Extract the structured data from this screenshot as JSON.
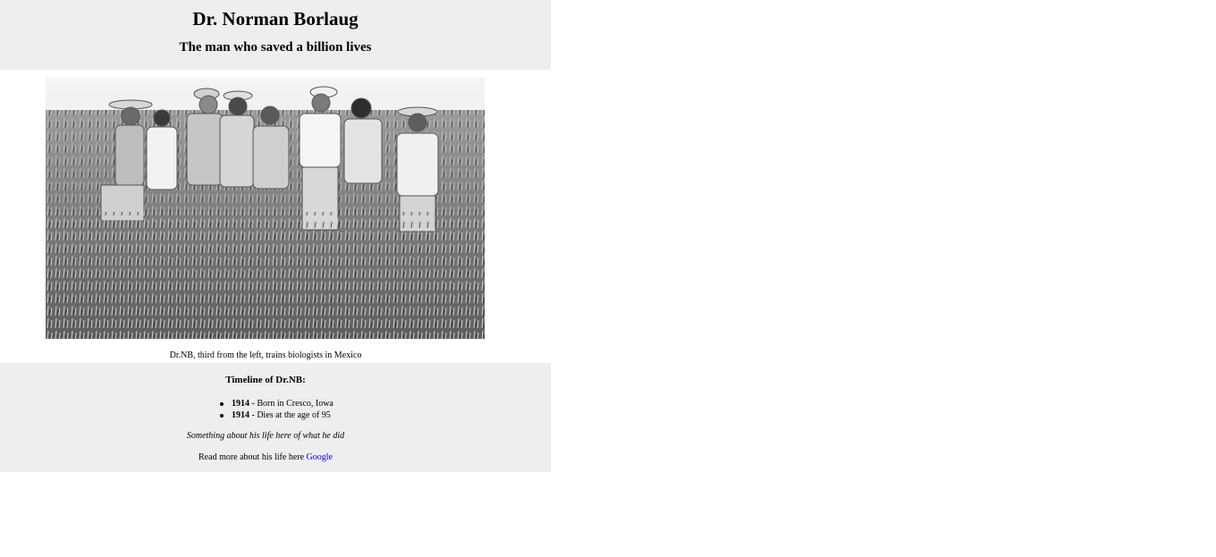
{
  "header": {
    "title": "Dr. Norman Borlaug",
    "subtitle": "The man who saved a billion lives"
  },
  "photo": {
    "caption": "Dr.NB, third from the left, trains biologists in Mexico"
  },
  "timeline": {
    "heading": "Timeline of Dr.NB:",
    "events": [
      {
        "year": "1914",
        "text": " - Born in Cresco, Iowa"
      },
      {
        "year": "1914",
        "text": " - Dies at the age of 95"
      }
    ],
    "about": "Something about his life here of what he did",
    "read_more_prefix": "Read more about his life here ",
    "read_more_link": "Google"
  }
}
